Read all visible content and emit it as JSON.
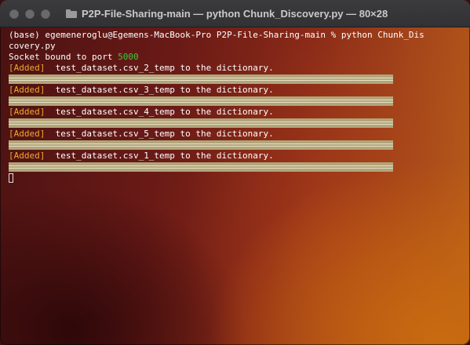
{
  "window": {
    "title": "P2P-File-Sharing-main — python Chunk_Discovery.py — 80×28"
  },
  "terminal": {
    "prompt_line_1": "(base) egemeneroglu@Egemens-MacBook-Pro P2P-File-Sharing-main % python Chunk_Dis",
    "prompt_line_2": "covery.py",
    "socket_text": "Socket bound to port ",
    "socket_port": "5000",
    "entries": [
      {
        "tag": "[Added]",
        "message": "  test_dataset.csv_2_temp to the dictionary."
      },
      {
        "tag": "[Added]",
        "message": "  test_dataset.csv_3_temp to the dictionary."
      },
      {
        "tag": "[Added]",
        "message": "  test_dataset.csv_4_temp to the dictionary."
      },
      {
        "tag": "[Added]",
        "message": "  test_dataset.csv_5_temp to the dictionary."
      },
      {
        "tag": "[Added]",
        "message": "  test_dataset.csv_1_temp to the dictionary."
      }
    ]
  },
  "colors": {
    "port": "#3cc63c",
    "added_tag": "#f0a830",
    "separator": "#b2a57a"
  },
  "icons": {
    "title_icon": "folder-icon",
    "traffic_lights": [
      "close-icon",
      "minimize-icon",
      "zoom-icon"
    ]
  }
}
